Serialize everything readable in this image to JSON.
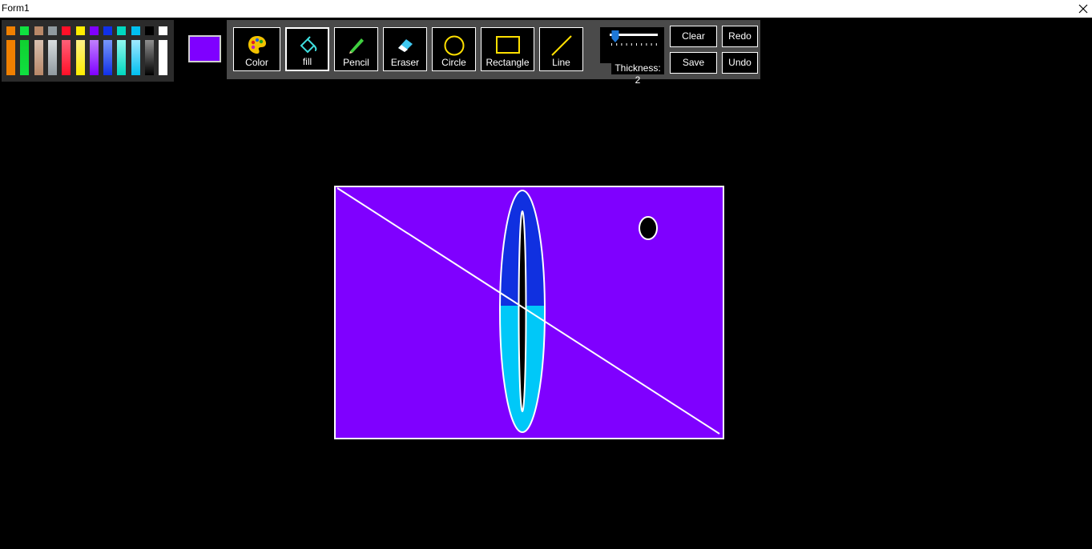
{
  "window": {
    "title": "Form1",
    "close_icon": "close-icon"
  },
  "palette": {
    "colors": [
      {
        "name": "orange",
        "top": "#f08000",
        "shade": "#f08000"
      },
      {
        "name": "green",
        "top": "#10e040",
        "shade": "#10d030"
      },
      {
        "name": "tan",
        "top": "#b88868",
        "shade": "#d8c0b0"
      },
      {
        "name": "gray",
        "top": "#909aa0",
        "shade": "#d8dcdf"
      },
      {
        "name": "red",
        "top": "#ff1028",
        "shade": "#ff6078"
      },
      {
        "name": "yellow",
        "top": "#ffee00",
        "shade": "#fff088"
      },
      {
        "name": "violet",
        "top": "#8000ff",
        "shade": "#c080ff"
      },
      {
        "name": "blue",
        "top": "#1030e8",
        "shade": "#7898f8"
      },
      {
        "name": "teal",
        "top": "#00d8c0",
        "shade": "#90f8f0"
      },
      {
        "name": "sky",
        "top": "#00c0f0",
        "shade": "#a0e8ff"
      },
      {
        "name": "black",
        "top": "#000000",
        "shade": "#909090"
      },
      {
        "name": "white",
        "top": "#ffffff",
        "shade": "#ffffff"
      }
    ]
  },
  "current_color": "#7f00ff",
  "tools": [
    {
      "id": "color",
      "label": "Color",
      "icon": "palette-icon"
    },
    {
      "id": "fill",
      "label": "fill",
      "icon": "paint-bucket-icon",
      "active": true
    },
    {
      "id": "pencil",
      "label": "Pencil",
      "icon": "pencil-icon"
    },
    {
      "id": "eraser",
      "label": "Eraser",
      "icon": "eraser-icon"
    },
    {
      "id": "circle",
      "label": "Circle",
      "icon": "circle-icon"
    },
    {
      "id": "rectangle",
      "label": "Rectangle",
      "icon": "rectangle-icon"
    },
    {
      "id": "line",
      "label": "Line",
      "icon": "line-icon"
    }
  ],
  "thickness": {
    "label": "Thickness: 2",
    "value": 2,
    "min": 1,
    "max": 10
  },
  "actions": {
    "clear": "Clear",
    "redo": "Redo",
    "save": "Save",
    "undo": "Undo"
  },
  "canvas": {
    "background": "#7f00ff"
  }
}
